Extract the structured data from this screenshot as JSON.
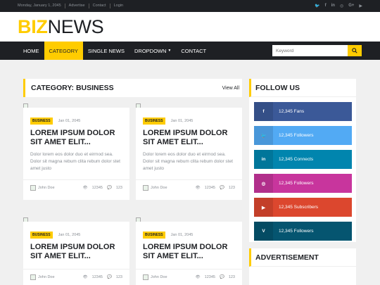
{
  "topbar": {
    "links": [
      "Monday, January 1, 2045",
      "Advertise",
      "Contact",
      "Login"
    ],
    "social_icons": [
      "twitter-icon",
      "facebook-icon",
      "linkedin-icon",
      "instagram-icon",
      "google-plus-icon",
      "youtube-icon"
    ]
  },
  "brand": {
    "logo_accent": "BIZ",
    "logo_main": "NEWS"
  },
  "nav": {
    "items": [
      {
        "label": "HOME"
      },
      {
        "label": "CATEGORY",
        "active": true
      },
      {
        "label": "SINGLE NEWS"
      },
      {
        "label": "DROPDOWN"
      },
      {
        "label": "CONTACT"
      }
    ],
    "search_placeholder": "Keyword",
    "search_icon": "search-icon"
  },
  "main": {
    "category_title": "CATEGORY: BUSINESS",
    "view_all": "View All",
    "posts": [
      {
        "badge": "BUSINESS",
        "date": "Jan 01, 2045",
        "title": "LOREM IPSUM DOLOR SIT AMET ELIT...",
        "excerpt": "Dolor lorem eos dolor duo et eirmod sea. Dolor sit magna rebum clita rebum dolor stet amet justo",
        "author": "John Doe",
        "views": "12345",
        "comments": "123"
      },
      {
        "badge": "BUSINESS",
        "date": "Jan 01, 2045",
        "title": "LOREM IPSUM DOLOR SIT AMET ELIT...",
        "excerpt": "Dolor lorem eos dolor duo et eirmod sea. Dolor sit magna rebum clita rebum dolor stet amet justo",
        "author": "John Doe",
        "views": "12345",
        "comments": "123"
      },
      {
        "badge": "BUSINESS",
        "date": "Jan 01, 2045",
        "title": "LOREM IPSUM DOLOR SIT AMET ELIT...",
        "author": "John Doe",
        "views": "12345",
        "comments": "123"
      },
      {
        "badge": "BUSINESS",
        "date": "Jan 01, 2045",
        "title": "LOREM IPSUM DOLOR SIT AMET ELIT...",
        "author": "John Doe",
        "views": "12345",
        "comments": "123"
      }
    ]
  },
  "sidebar": {
    "follow_title": "FOLLOW US",
    "socials": [
      {
        "icon": "f",
        "name": "facebook",
        "label": "12,345 Fans",
        "color": "#3b5998"
      },
      {
        "icon": "🐦",
        "name": "twitter",
        "label": "12,345 Followers",
        "color": "#52aaf4"
      },
      {
        "icon": "in",
        "name": "linkedin",
        "label": "12,345 Connects",
        "color": "#0185ae"
      },
      {
        "icon": "◎",
        "name": "instagram",
        "label": "12,345 Followers",
        "color": "#c8359d"
      },
      {
        "icon": "▶",
        "name": "youtube",
        "label": "12,345 Subscribers",
        "color": "#dc472e"
      },
      {
        "icon": "V",
        "name": "vimeo",
        "label": "12,345 Followers",
        "color": "#055570"
      }
    ],
    "ad_title": "ADVERTISEMENT"
  },
  "colors": {
    "accent": "#ffcc00",
    "dark": "#1e2024",
    "muted": "#8a8f95"
  }
}
